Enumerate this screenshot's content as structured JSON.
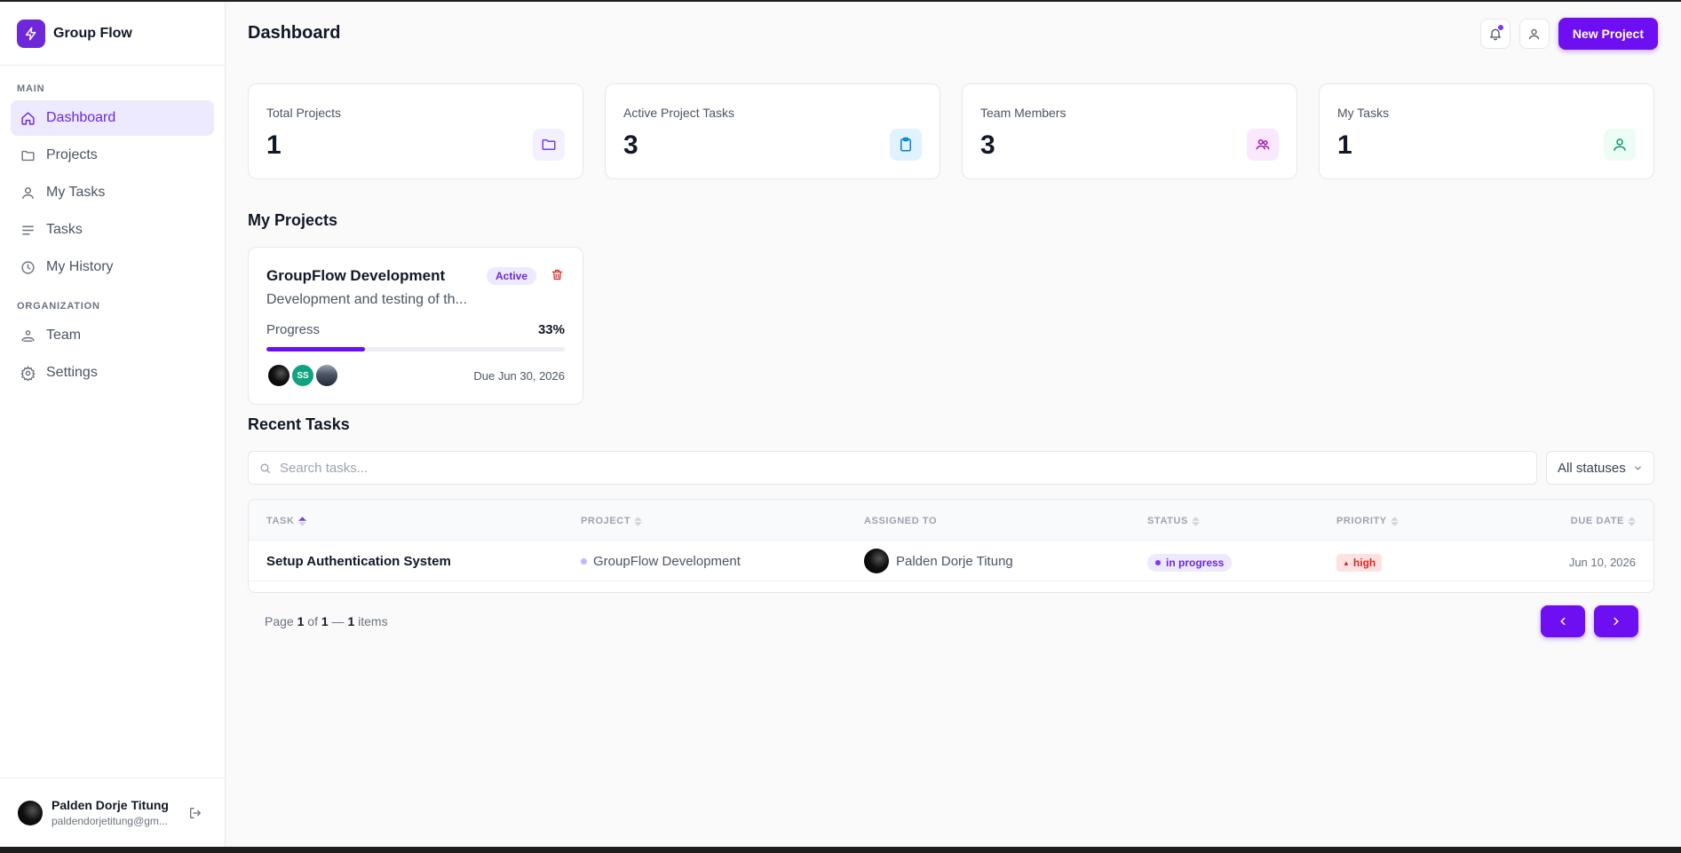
{
  "brand": {
    "name": "Group Flow"
  },
  "sidebar": {
    "sections": [
      {
        "label": "MAIN",
        "items": [
          {
            "label": "Dashboard",
            "icon": "home-icon",
            "active": true
          },
          {
            "label": "Projects",
            "icon": "folder-icon"
          },
          {
            "label": "My Tasks",
            "icon": "user-icon"
          },
          {
            "label": "Tasks",
            "icon": "list-icon"
          },
          {
            "label": "My History",
            "icon": "clock-icon"
          }
        ]
      },
      {
        "label": "ORGANIZATION",
        "items": [
          {
            "label": "Team",
            "icon": "team-icon"
          },
          {
            "label": "Settings",
            "icon": "gear-icon"
          }
        ]
      }
    ],
    "user": {
      "name": "Palden Dorje Titung",
      "email": "paldendorjetitung@gm..."
    }
  },
  "header": {
    "title": "Dashboard",
    "new_project_label": "New Project"
  },
  "stats": [
    {
      "label": "Total Projects",
      "value": "1",
      "icon": "folder-icon",
      "color": "#7c3aed",
      "bg": "#f3f0ff"
    },
    {
      "label": "Active Project Tasks",
      "value": "3",
      "icon": "clipboard-icon",
      "color": "#0284c7",
      "bg": "#e0f2fe"
    },
    {
      "label": "Team Members",
      "value": "3",
      "icon": "users-icon",
      "color": "#a21caf",
      "bg": "#fae8ff"
    },
    {
      "label": "My Tasks",
      "value": "1",
      "icon": "user-icon",
      "color": "#059669",
      "bg": "#ecfdf5"
    }
  ],
  "my_projects": {
    "title": "My Projects",
    "cards": [
      {
        "title": "GroupFlow Development",
        "status": "Active",
        "description": "Development and testing of th...",
        "progress_label": "Progress",
        "progress_text": "33%",
        "progress": 0.33,
        "avatar_initials": "SS",
        "due": "Due Jun 30, 2026"
      }
    ]
  },
  "recent_tasks": {
    "title": "Recent Tasks",
    "search_placeholder": "Search tasks...",
    "status_filter": "All statuses",
    "columns": [
      "TASK",
      "PROJECT",
      "ASSIGNED TO",
      "STATUS",
      "PRIORITY",
      "DUE DATE"
    ],
    "rows": [
      {
        "task": "Setup Authentication System",
        "project": "GroupFlow Development",
        "assignee": "Palden Dorje Titung",
        "status": "in progress",
        "priority": "high",
        "due": "Jun 10, 2026"
      }
    ],
    "pager": {
      "prefix": "Page",
      "page": "1",
      "of": "of",
      "pages": "1",
      "sep": "—",
      "items": "1",
      "items_label": "items"
    }
  },
  "colors": {
    "accent": "#6d0ff0",
    "danger": "#dc2626"
  }
}
